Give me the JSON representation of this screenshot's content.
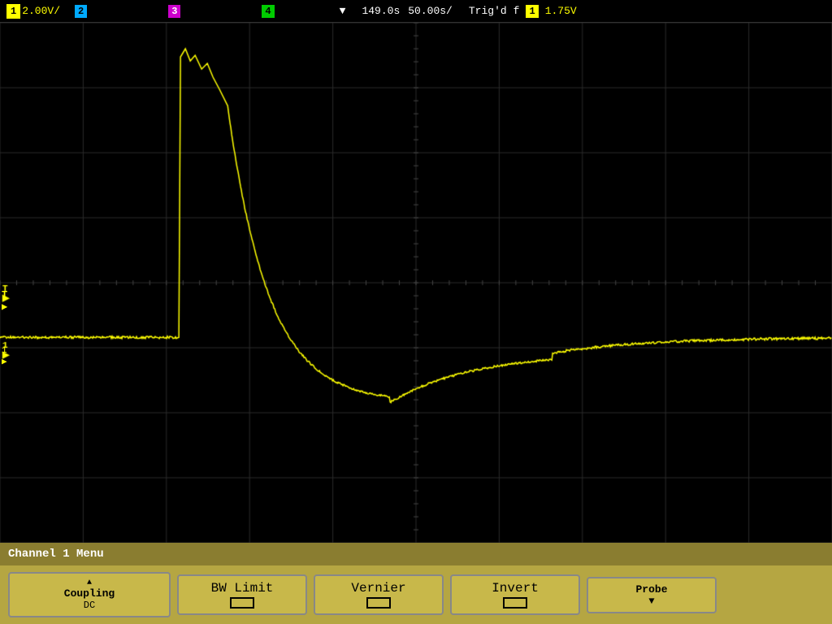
{
  "topbar": {
    "ch1_badge": "1",
    "ch1_scale": "2.00V/",
    "ch2_badge": "2",
    "ch3_badge": "3",
    "ch4_badge": "4",
    "time_position": "149.0s",
    "time_scale": "50.00s/",
    "trig_status": "Trig'd",
    "trig_symbol": "f",
    "trig_ch_badge": "1",
    "trig_level": "1.75V"
  },
  "channel_menu": {
    "title": "Channel 1  Menu"
  },
  "buttons": {
    "coupling_label": "Coupling",
    "coupling_value": "DC",
    "bw_limit_label": "BW Limit",
    "vernier_label": "Vernier",
    "invert_label": "Invert",
    "probe_label": "Probe",
    "probe_arrow": "▼"
  },
  "colors": {
    "waveform": "#ffff00",
    "grid": "#333333",
    "background": "#000000",
    "menu_bg": "#b5a642",
    "btn_bg": "#c8b84a"
  }
}
